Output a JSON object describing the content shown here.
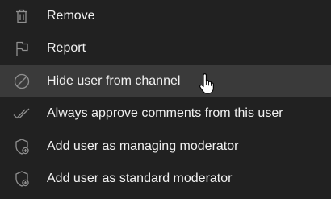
{
  "menu": {
    "items": [
      {
        "label": "Remove",
        "icon": "trash-icon"
      },
      {
        "label": "Report",
        "icon": "flag-icon"
      },
      {
        "label": "Hide user from channel",
        "icon": "block-icon",
        "hovered": true
      },
      {
        "label": "Always approve comments from this user",
        "icon": "double-check-icon"
      },
      {
        "label": "Add user as managing moderator",
        "icon": "shield-add-icon"
      },
      {
        "label": "Add user as standard moderator",
        "icon": "shield-add-icon"
      }
    ]
  },
  "colors": {
    "background": "#212121",
    "hover_background": "#3a3a3a",
    "text": "#f1f1f1",
    "icon": "#909090"
  }
}
